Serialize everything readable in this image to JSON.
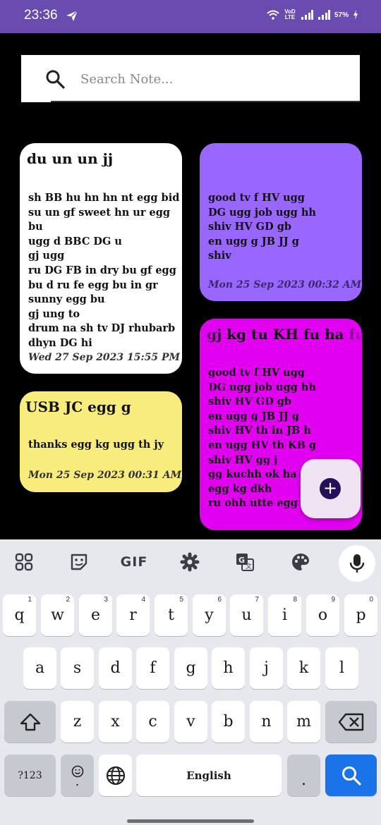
{
  "status_bar": {
    "time": "23:36",
    "network_label": "VoD LTE",
    "battery": "57%",
    "icons": [
      "send-icon",
      "wifi-icon",
      "signal-icon",
      "battery-charging-icon"
    ]
  },
  "search": {
    "placeholder": "Search Note..."
  },
  "notes": [
    {
      "title": "du un un jj",
      "body": "sh BB hu hn hn nt egg bid\nsu un gf sweet hn ur egg bu\nugg d BBC DG u\ngj ugg\nru DG FB in dry bu gf egg\nbu d ru fe egg bu in gr\nsunny egg bu\ngj ung to\ndrum na sh tv DJ rhubarb\ndhyn DG hi",
      "date": "Wed 27 Sep 2023 15:55 PM",
      "color": "#ffffff"
    },
    {
      "title": "",
      "body": "good tv f HV ugg\nDG ugg job ugg hh\nshiv HV GD gb\nen ugg g JB JJ g\nshiv",
      "date": "Mon 25 Sep 2023 00:32 AM",
      "color": "#9966ff"
    },
    {
      "title": "USB JC egg g",
      "body": "thanks egg kg ugg th jy",
      "date": "Mon 25 Sep 2023 00:31 AM",
      "color": "#f8ed7c"
    },
    {
      "title": "gj kg tu KH fu ha fu",
      "body": "good tv f HV ugg\nDG ugg job ugg hh\nshiv HV GD gb\nen ugg g JB JJ g\nshiv HV th in JB h\nen ugg HV th KB g\nshiv HV gg j\ngg kuchh ok ha\negg kg dkh\nru ohh utte egg k",
      "color": "#e100f0"
    }
  ],
  "fab": {
    "icon": "add-icon",
    "label": "+"
  },
  "keyboard": {
    "toolbar": {
      "gif_label": "GIF"
    },
    "row1": [
      {
        "k": "q",
        "h": "1"
      },
      {
        "k": "w",
        "h": "2"
      },
      {
        "k": "e",
        "h": "3"
      },
      {
        "k": "r",
        "h": "4"
      },
      {
        "k": "t",
        "h": "5"
      },
      {
        "k": "y",
        "h": "6"
      },
      {
        "k": "u",
        "h": "7"
      },
      {
        "k": "i",
        "h": "8"
      },
      {
        "k": "o",
        "h": "9"
      },
      {
        "k": "p",
        "h": "0"
      }
    ],
    "row2": [
      "a",
      "s",
      "d",
      "f",
      "g",
      "h",
      "j",
      "k",
      "l"
    ],
    "row3": [
      "z",
      "x",
      "c",
      "v",
      "b",
      "n",
      "m"
    ],
    "symbols_label": "?123",
    "space_label": "English",
    "period_label": ".",
    "emoji_sub": "."
  },
  "colors": {
    "status_bar": "#6a4cb0",
    "search_key": "#1a73e8"
  }
}
